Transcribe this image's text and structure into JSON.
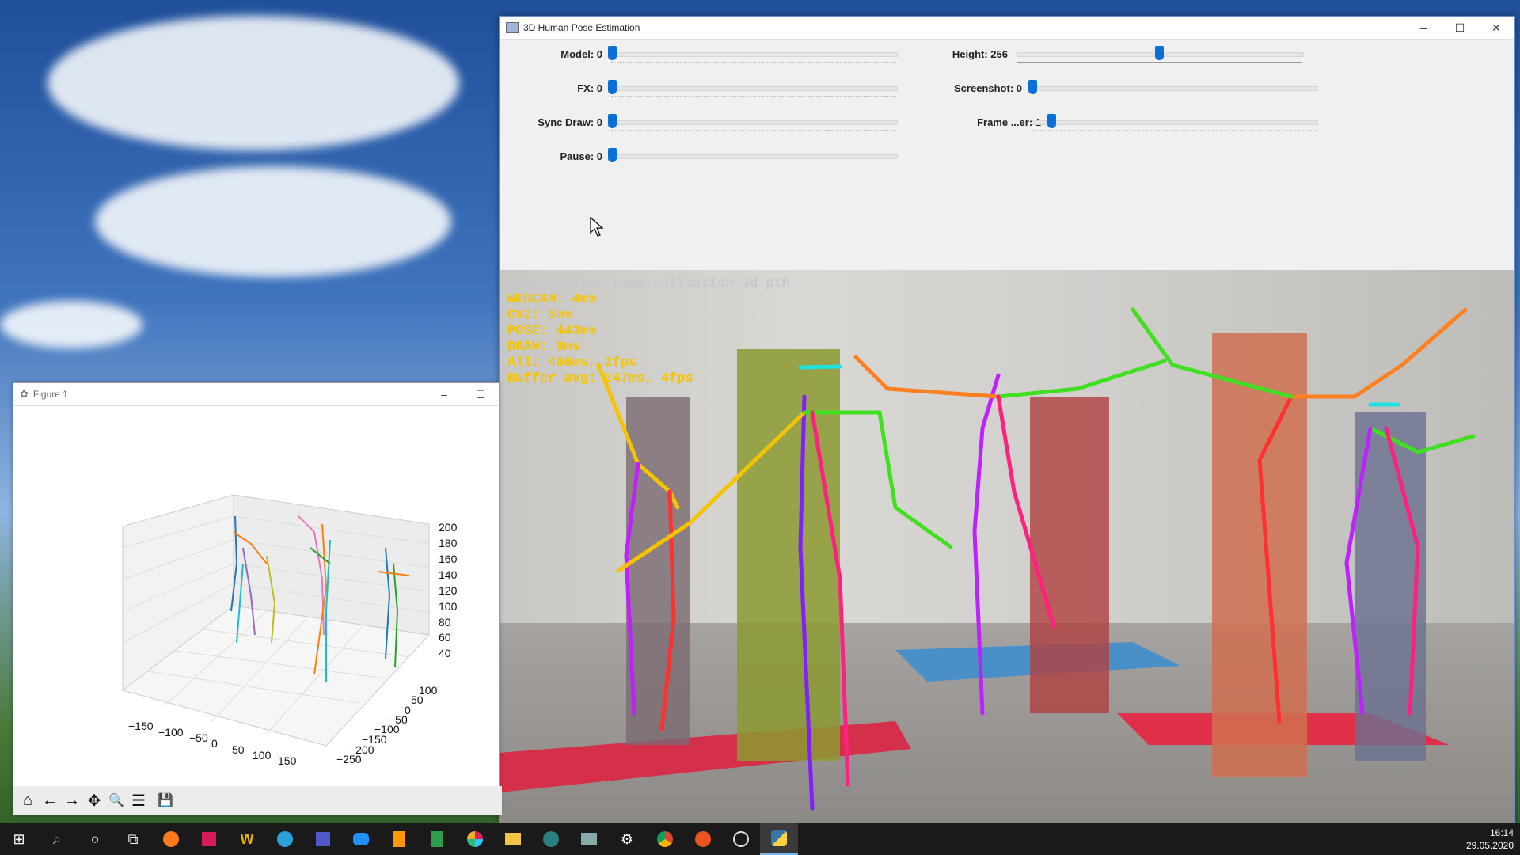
{
  "main_window": {
    "title": "3D Human Pose Estimation",
    "buttons": {
      "minimize": "–",
      "maximize": "☐",
      "close": "✕"
    },
    "sliders": [
      {
        "label": "Model: 0",
        "value": 0
      },
      {
        "label": "FX: 0",
        "value": 0
      },
      {
        "label": "Sync Draw: 0",
        "value": 0
      },
      {
        "label": "Pause: 0",
        "value": 0
      },
      {
        "label": "Height: 256",
        "value": 0.5
      },
      {
        "label": "Screenshot: 0",
        "value": 0
      },
      {
        "label": "Frame ...er: 1",
        "value": 0.07
      }
    ],
    "overlay": {
      "model": "Model: human-pose-estimation-3d.pth",
      "webcam": "WEBCAM: 4ms",
      "cv2": "CV2: 5ms",
      "pose": "POSE: 443ms",
      "draw": "DRAW: 9ms",
      "all": "All: 466ms, 2fps",
      "buffer": "Buffer avg: 247ms, 4fps"
    },
    "colors": {
      "overlay_model": "#c8c8c8",
      "overlay_stats": "#f5c400",
      "slider_thumb": "#0a6fd6"
    }
  },
  "figure_window": {
    "title": "Figure 1",
    "buttons": {
      "minimize": "–",
      "maximize": "☐"
    },
    "z_ticks": [
      "200",
      "180",
      "160",
      "140",
      "120",
      "100",
      "80",
      "60",
      "40"
    ],
    "x_ticks": [
      "−150",
      "−100",
      "−50",
      "0",
      "50",
      "100",
      "150"
    ],
    "y_ticks": [
      "100",
      "50",
      "0",
      "−50",
      "−100",
      "−150",
      "−200",
      "−250"
    ],
    "toolbar": {
      "home": "⌂",
      "back": "←",
      "forward": "→",
      "pan": "✥",
      "zoom": "🔍",
      "configure": "☰",
      "save": "💾"
    }
  },
  "taskbar": {
    "start": "⊞",
    "search": "⌕",
    "cortana": "○",
    "task_view": "⧉",
    "apps": [
      "firefox",
      "intellij",
      "wps",
      "telegram",
      "teams",
      "chat",
      "sublime",
      "sheets",
      "slack",
      "explorer",
      "browser",
      "wifi",
      "settings",
      "chrome",
      "ubuntu",
      "obs",
      "python"
    ],
    "time": "16:14",
    "date": "29.05.2020"
  }
}
